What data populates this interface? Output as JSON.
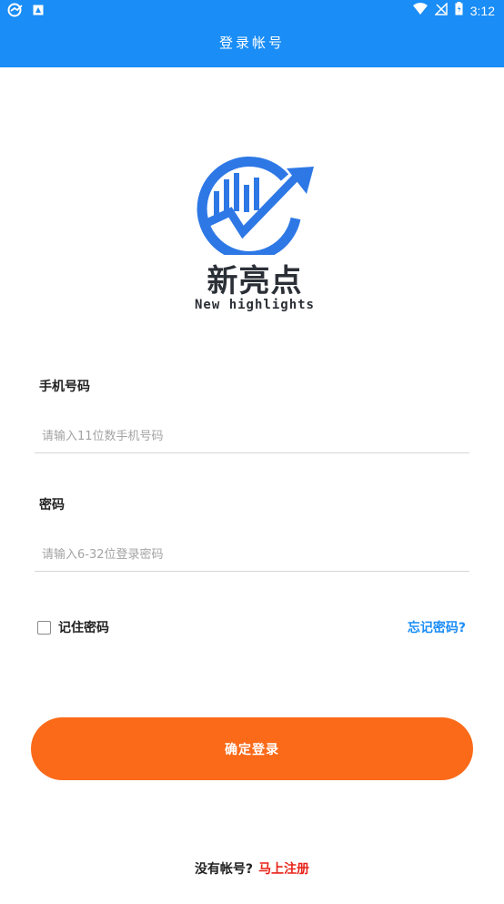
{
  "status_bar": {
    "time": "3:12",
    "icons_left": [
      "app-notification-icon",
      "image-notification-icon"
    ],
    "icons_right": [
      "wifi-icon",
      "no-signal-icon",
      "battery-icon"
    ]
  },
  "header": {
    "title": "登录帐号"
  },
  "logo": {
    "name_cn": "新亮点",
    "name_en": "New highlights",
    "colors": {
      "blue": "#2e78e6",
      "dark": "#2b2f36"
    }
  },
  "form": {
    "phone": {
      "label": "手机号码",
      "placeholder": "请输入11位数手机号码",
      "value": ""
    },
    "password": {
      "label": "密码",
      "placeholder": "请输入6-32位登录密码",
      "value": ""
    },
    "remember": {
      "label": "记住密码",
      "checked": false
    },
    "forgot_label": "忘记密码?"
  },
  "submit": {
    "label": "确定登录"
  },
  "footer": {
    "question": "没有帐号?",
    "register_label": "马上注册"
  },
  "colors": {
    "primary": "#1a8df6",
    "accent": "#fb6a18",
    "link_red": "#e8241a"
  }
}
